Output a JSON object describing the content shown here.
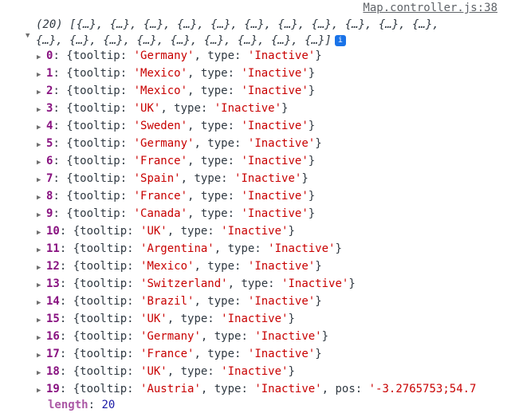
{
  "source_link": "Map.controller.js:38",
  "header": {
    "line1": "(20) [{…}, {…}, {…}, {…}, {…}, {…}, {…}, {…}, {…}, {…}, {…},",
    "line2": "{…}, {…}, {…}, {…}, {…}, {…}, {…}, {…}, {…}]",
    "info_icon": "i"
  },
  "items": [
    {
      "index": "0",
      "tooltip": "'Germany'",
      "type": "'Inactive'"
    },
    {
      "index": "1",
      "tooltip": "'Mexico'",
      "type": "'Inactive'"
    },
    {
      "index": "2",
      "tooltip": "'Mexico'",
      "type": "'Inactive'"
    },
    {
      "index": "3",
      "tooltip": "'UK'",
      "type": "'Inactive'"
    },
    {
      "index": "4",
      "tooltip": "'Sweden'",
      "type": "'Inactive'"
    },
    {
      "index": "5",
      "tooltip": "'Germany'",
      "type": "'Inactive'"
    },
    {
      "index": "6",
      "tooltip": "'France'",
      "type": "'Inactive'"
    },
    {
      "index": "7",
      "tooltip": "'Spain'",
      "type": "'Inactive'"
    },
    {
      "index": "8",
      "tooltip": "'France'",
      "type": "'Inactive'"
    },
    {
      "index": "9",
      "tooltip": "'Canada'",
      "type": "'Inactive'"
    },
    {
      "index": "10",
      "tooltip": "'UK'",
      "type": "'Inactive'"
    },
    {
      "index": "11",
      "tooltip": "'Argentina'",
      "type": "'Inactive'"
    },
    {
      "index": "12",
      "tooltip": "'Mexico'",
      "type": "'Inactive'"
    },
    {
      "index": "13",
      "tooltip": "'Switzerland'",
      "type": "'Inactive'"
    },
    {
      "index": "14",
      "tooltip": "'Brazil'",
      "type": "'Inactive'"
    },
    {
      "index": "15",
      "tooltip": "'UK'",
      "type": "'Inactive'"
    },
    {
      "index": "16",
      "tooltip": "'Germany'",
      "type": "'Inactive'"
    },
    {
      "index": "17",
      "tooltip": "'France'",
      "type": "'Inactive'"
    },
    {
      "index": "18",
      "tooltip": "'UK'",
      "type": "'Inactive'"
    },
    {
      "index": "19",
      "tooltip": "'Austria'",
      "type": "'Inactive'",
      "pos": "'-3.2765753;54.7"
    }
  ],
  "length": {
    "label": "length",
    "value": "20"
  }
}
